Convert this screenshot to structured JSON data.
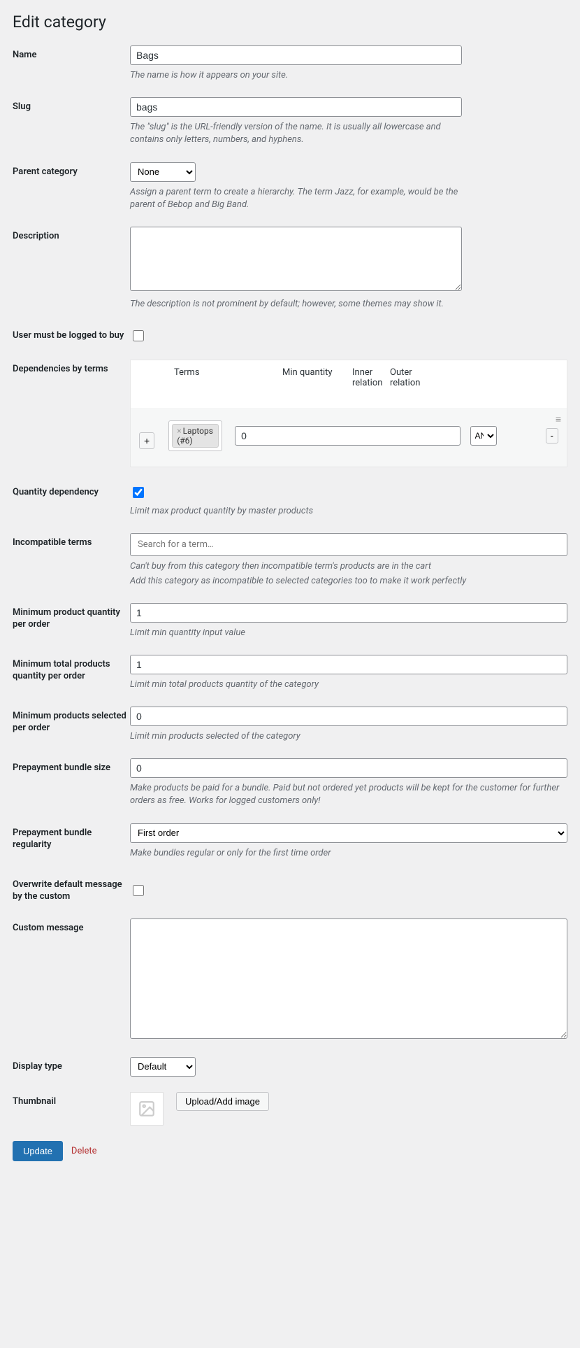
{
  "page_title": "Edit category",
  "fields": {
    "name": {
      "label": "Name",
      "value": "Bags",
      "desc": "The name is how it appears on your site."
    },
    "slug": {
      "label": "Slug",
      "value": "bags",
      "desc": "The \"slug\" is the URL-friendly version of the name. It is usually all lowercase and contains only letters, numbers, and hyphens."
    },
    "parent": {
      "label": "Parent category",
      "value": "None",
      "desc": "Assign a parent term to create a hierarchy. The term Jazz, for example, would be the parent of Bebop and Big Band."
    },
    "description": {
      "label": "Description",
      "value": "",
      "desc": "The description is not prominent by default; however, some themes may show it."
    },
    "logged_buy": {
      "label": "User must be logged to buy",
      "checked": false
    },
    "dependencies": {
      "label": "Dependencies by terms",
      "headers": {
        "terms": "Terms",
        "minq": "Min quantity",
        "inner": "Inner relation",
        "outer": "Outer relation"
      },
      "add_label": "+",
      "rows": [
        {
          "tags": [
            "Laptops (#6)"
          ],
          "min_qty": "0",
          "inner": "AND",
          "remove_label": "-"
        }
      ],
      "tag_x": "×"
    },
    "quantity_dep": {
      "label": "Quantity dependency",
      "checked": true,
      "desc": "Limit max product quantity by master products"
    },
    "incompat": {
      "label": "Incompatible terms",
      "placeholder": "Search for a term…",
      "desc1": "Can't buy from this category then incompatible term's products are in the cart",
      "desc2": "Add this category as incompatible to selected categories too to make it work perfectly"
    },
    "min_prod_qty": {
      "label": "Minimum product quantity per order",
      "value": "1",
      "desc": "Limit min quantity input value"
    },
    "min_total_qty": {
      "label": "Minimum total products quantity per order",
      "value": "1",
      "desc": "Limit min total products quantity of the category"
    },
    "min_selected": {
      "label": "Minimum products selected per order",
      "value": "0",
      "desc": "Limit min products selected of the category"
    },
    "prepay_size": {
      "label": "Prepayment bundle size",
      "value": "0",
      "desc": "Make products be paid for a bundle. Paid but not ordered yet products will be kept for the customer for further orders as free. Works for logged customers only!"
    },
    "prepay_reg": {
      "label": "Prepayment bundle regularity",
      "value": "First order",
      "desc": "Make bundles regular or only for the first time order"
    },
    "overwrite_msg": {
      "label": "Overwrite default message by the custom",
      "checked": false
    },
    "custom_msg": {
      "label": "Custom message",
      "value": ""
    },
    "display_type": {
      "label": "Display type",
      "value": "Default"
    },
    "thumbnail": {
      "label": "Thumbnail",
      "upload_label": "Upload/Add image"
    }
  },
  "actions": {
    "update": "Update",
    "delete": "Delete"
  }
}
